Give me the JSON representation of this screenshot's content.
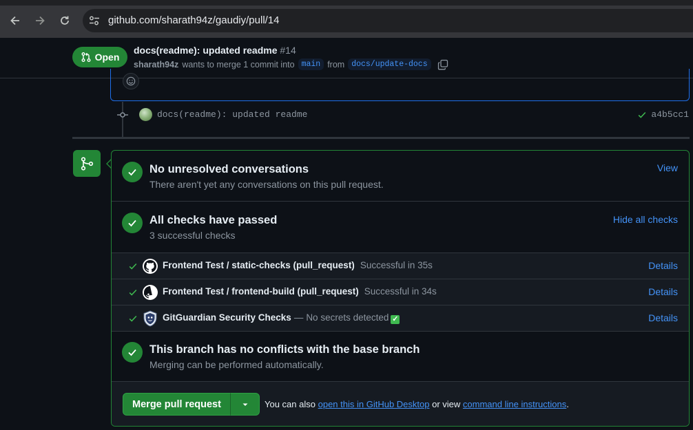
{
  "browser": {
    "url_host": "github.com",
    "url_path": "/sharath94z/gaudiy/pull/14"
  },
  "pr": {
    "state": "Open",
    "title": "docs(readme): updated readme",
    "number": "#14",
    "author": "sharath94z",
    "merge_text": "wants to merge 1 commit into",
    "base_branch": "main",
    "from_text": "from",
    "head_branch": "docs/update-docs"
  },
  "commit": {
    "message": "docs(readme): updated readme",
    "sha": "a4b5cc1"
  },
  "merge_box": {
    "conversations": {
      "title": "No unresolved conversations",
      "subtitle": "There aren't yet any conversations on this pull request.",
      "link": "View"
    },
    "checks": {
      "title": "All checks have passed",
      "subtitle": "3 successful checks",
      "link": "Hide all checks",
      "items": [
        {
          "name": "Frontend Test / static-checks (pull_request)",
          "status": "Successful in 35s",
          "link": "Details"
        },
        {
          "name": "Frontend Test / frontend-build (pull_request)",
          "status": "Successful in 34s",
          "link": "Details"
        },
        {
          "name": "GitGuardian Security Checks",
          "dash": "—",
          "status": "No secrets detected",
          "link": "Details"
        }
      ]
    },
    "conflicts": {
      "title": "This branch has no conflicts with the base branch",
      "subtitle": "Merging can be performed automatically."
    },
    "merge": {
      "button_label": "Merge pull request",
      "also_text": "You can also",
      "desktop_link": "open this in GitHub Desktop",
      "or_view": "or view",
      "cli_link": "command line instructions",
      "period": "."
    }
  },
  "colors": {
    "success": "#238636",
    "link": "#4493f8",
    "background": "#0d1117"
  }
}
